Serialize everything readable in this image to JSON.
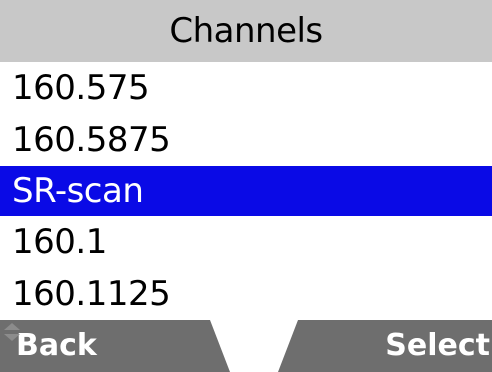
{
  "header": {
    "title": "Channels"
  },
  "channels": [
    {
      "label": "160.575",
      "selected": false
    },
    {
      "label": "160.5875",
      "selected": false
    },
    {
      "label": "SR-scan",
      "selected": true
    },
    {
      "label": "160.1",
      "selected": false
    },
    {
      "label": "160.1125",
      "selected": false
    }
  ],
  "softkeys": {
    "left_label": "Back",
    "center_icon": "up-down-navigation-icon",
    "right_label": "Select"
  },
  "colors": {
    "header_bg": "#c8c8c8",
    "selection_bg": "#0a0ae6",
    "softkey_bg": "#6e6e6e"
  }
}
